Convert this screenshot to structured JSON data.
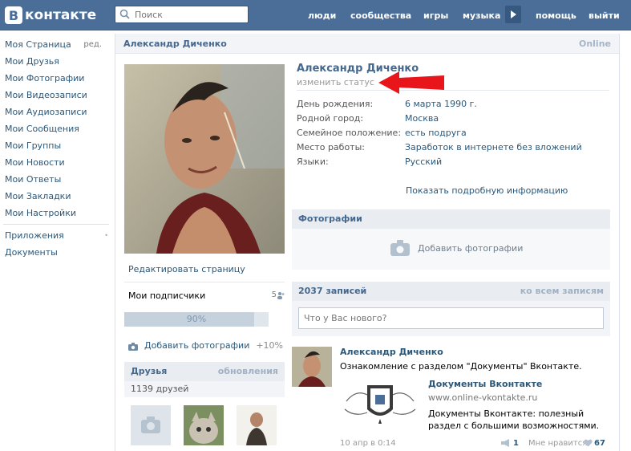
{
  "header": {
    "logo_letter": "В",
    "logo_text": "контакте",
    "search_placeholder": "Поиск",
    "nav": [
      "люди",
      "сообщества",
      "игры",
      "музыка",
      "помощь",
      "выйти"
    ]
  },
  "sidebar": {
    "items": [
      "Моя Страница",
      "Мои Друзья",
      "Мои Фотографии",
      "Мои Видеозаписи",
      "Мои Аудиозаписи",
      "Мои Сообщения",
      "Мои Группы",
      "Мои Новости",
      "Мои Ответы",
      "Мои Закладки",
      "Мои Настройки"
    ],
    "edit_label": "ред.",
    "extra": [
      "Приложения",
      "Документы"
    ]
  },
  "profile": {
    "header_name": "Александр Диченко",
    "online": "Online",
    "name": "Александр Диченко",
    "status_link": "изменить статус",
    "fields": [
      {
        "k": "День рождения:",
        "v": "6 марта 1990 г."
      },
      {
        "k": "Родной город:",
        "v": "Москва"
      },
      {
        "k": "Семейное положение:",
        "v": "есть подруга"
      },
      {
        "k": "Место работы:",
        "v": "Заработок в интернете без вложений"
      },
      {
        "k": "Языки:",
        "v": "Русский"
      }
    ],
    "more_info": "Показать подробную информацию"
  },
  "left_column": {
    "edit_page": "Редактировать страницу",
    "subscribers_label": "Мои подписчики",
    "subscribers_count": "5",
    "progress_label": "90%",
    "progress_value": 0.9,
    "add_photos": "Добавить фотографии",
    "add_photos_bonus": "+10%",
    "friends_title": "Друзья",
    "friends_updates": "обновления",
    "friends_count": "1139 друзей"
  },
  "photos_section": {
    "title": "Фотографии",
    "add_label": "Добавить фотографии"
  },
  "wall": {
    "title": "2037 записей",
    "all_link": "ко всем записям",
    "composer_placeholder": "Что у Вас нового?"
  },
  "post": {
    "author": "Александр Диченко",
    "text": "Ознакомление с разделом \"Документы\" Вконтакте.",
    "attachment_title": "Документы Вконтакте",
    "attachment_url": "www.online-vkontakte.ru",
    "attachment_desc": "Документы Вконтакте: полезный раздел с большими возможностями.",
    "date": "10 апр в 0:14",
    "reposts": "1",
    "like_label": "Мне нравится",
    "likes": "67"
  },
  "colors": {
    "header_bg": "#4a6e98",
    "link": "#2b587a",
    "annotation_arrow": "#e8161b"
  }
}
